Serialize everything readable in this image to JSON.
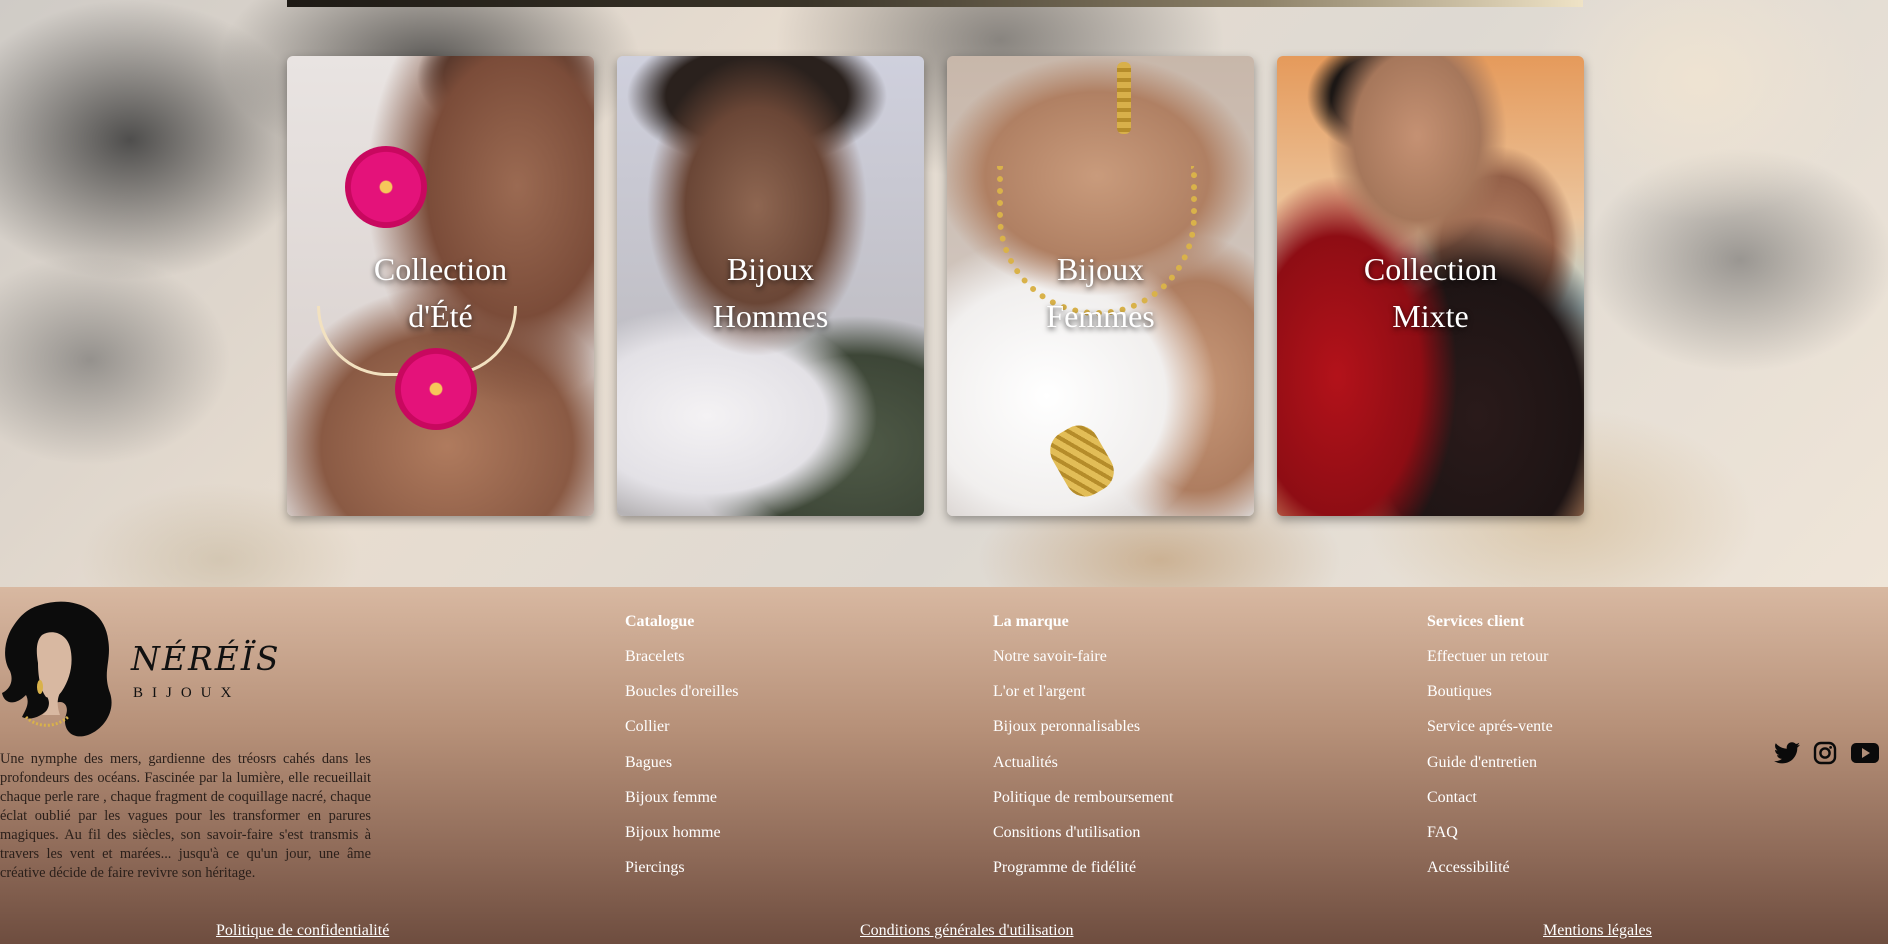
{
  "collections": [
    {
      "line1": "Collection",
      "line2": "d'Été"
    },
    {
      "line1": "Bijoux",
      "line2": "Hommes"
    },
    {
      "line1": "Bijoux",
      "line2": "Femmes"
    },
    {
      "line1": "Collection",
      "line2": "Mixte"
    }
  ],
  "footer": {
    "brand": {
      "name": "NÉRÉÏS",
      "sub": "BIJOUX"
    },
    "about": "Une nymphe des mers, gardienne des tréosrs cahés dans les profondeurs des océans. Fascinée par la lumière, elle recueillait chaque perle rare , chaque fragment de coquillage nacré, chaque éclat oublié par les vagues pour les transformer en parures magiques. Au fil des siècles, son savoir-faire s'est transmis à travers les vent et marées... jusqu'à ce qu'un jour, une âme créative décide de faire revivre son héritage.",
    "columns": [
      {
        "title": "Catalogue",
        "links": [
          "Bracelets",
          "Boucles d'oreilles",
          "Collier",
          "Bagues",
          "Bijoux femme",
          "Bijoux homme",
          "Piercings"
        ]
      },
      {
        "title": "La marque",
        "links": [
          "Notre savoir-faire",
          "L'or et l'argent",
          "Bijoux peronnalisables",
          "Actualités",
          "Politique de remboursement",
          "Consitions d'utilisation",
          "Programme de fidélité"
        ]
      },
      {
        "title": "Services client",
        "links": [
          "Effectuer un retour",
          "Boutiques",
          "Service aprés-vente",
          "Guide d'entretien",
          "Contact",
          "FAQ",
          "Accessibilité"
        ]
      }
    ],
    "social": [
      "twitter-icon",
      "instagram-icon",
      "youtube-icon"
    ],
    "legal": [
      "Politique de confidentialité",
      "Conditions générales d'utilisation",
      "Mentions légales"
    ]
  },
  "colors": {
    "footer_top": "#d8b8a1",
    "footer_bottom": "#6e4d3f",
    "link": "#ffffff",
    "accent_pink": "#e4127a",
    "accent_gold": "#d9b24a"
  }
}
